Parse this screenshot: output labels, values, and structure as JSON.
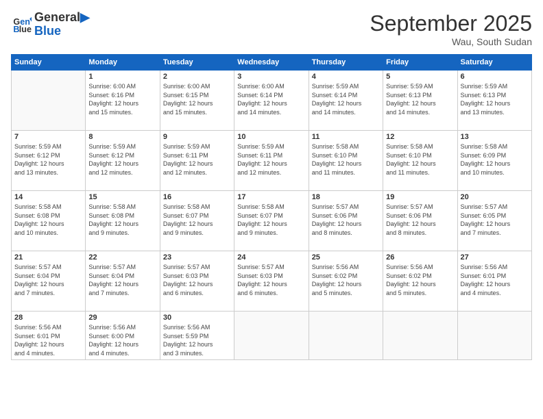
{
  "header": {
    "logo_line1": "General",
    "logo_line2": "Blue",
    "month": "September 2025",
    "location": "Wau, South Sudan"
  },
  "weekdays": [
    "Sunday",
    "Monday",
    "Tuesday",
    "Wednesday",
    "Thursday",
    "Friday",
    "Saturday"
  ],
  "weeks": [
    [
      {
        "day": "",
        "info": ""
      },
      {
        "day": "1",
        "info": "Sunrise: 6:00 AM\nSunset: 6:16 PM\nDaylight: 12 hours\nand 15 minutes."
      },
      {
        "day": "2",
        "info": "Sunrise: 6:00 AM\nSunset: 6:15 PM\nDaylight: 12 hours\nand 15 minutes."
      },
      {
        "day": "3",
        "info": "Sunrise: 6:00 AM\nSunset: 6:14 PM\nDaylight: 12 hours\nand 14 minutes."
      },
      {
        "day": "4",
        "info": "Sunrise: 5:59 AM\nSunset: 6:14 PM\nDaylight: 12 hours\nand 14 minutes."
      },
      {
        "day": "5",
        "info": "Sunrise: 5:59 AM\nSunset: 6:13 PM\nDaylight: 12 hours\nand 14 minutes."
      },
      {
        "day": "6",
        "info": "Sunrise: 5:59 AM\nSunset: 6:13 PM\nDaylight: 12 hours\nand 13 minutes."
      }
    ],
    [
      {
        "day": "7",
        "info": "Sunrise: 5:59 AM\nSunset: 6:12 PM\nDaylight: 12 hours\nand 13 minutes."
      },
      {
        "day": "8",
        "info": "Sunrise: 5:59 AM\nSunset: 6:12 PM\nDaylight: 12 hours\nand 12 minutes."
      },
      {
        "day": "9",
        "info": "Sunrise: 5:59 AM\nSunset: 6:11 PM\nDaylight: 12 hours\nand 12 minutes."
      },
      {
        "day": "10",
        "info": "Sunrise: 5:59 AM\nSunset: 6:11 PM\nDaylight: 12 hours\nand 12 minutes."
      },
      {
        "day": "11",
        "info": "Sunrise: 5:58 AM\nSunset: 6:10 PM\nDaylight: 12 hours\nand 11 minutes."
      },
      {
        "day": "12",
        "info": "Sunrise: 5:58 AM\nSunset: 6:10 PM\nDaylight: 12 hours\nand 11 minutes."
      },
      {
        "day": "13",
        "info": "Sunrise: 5:58 AM\nSunset: 6:09 PM\nDaylight: 12 hours\nand 10 minutes."
      }
    ],
    [
      {
        "day": "14",
        "info": "Sunrise: 5:58 AM\nSunset: 6:08 PM\nDaylight: 12 hours\nand 10 minutes."
      },
      {
        "day": "15",
        "info": "Sunrise: 5:58 AM\nSunset: 6:08 PM\nDaylight: 12 hours\nand 9 minutes."
      },
      {
        "day": "16",
        "info": "Sunrise: 5:58 AM\nSunset: 6:07 PM\nDaylight: 12 hours\nand 9 minutes."
      },
      {
        "day": "17",
        "info": "Sunrise: 5:58 AM\nSunset: 6:07 PM\nDaylight: 12 hours\nand 9 minutes."
      },
      {
        "day": "18",
        "info": "Sunrise: 5:57 AM\nSunset: 6:06 PM\nDaylight: 12 hours\nand 8 minutes."
      },
      {
        "day": "19",
        "info": "Sunrise: 5:57 AM\nSunset: 6:06 PM\nDaylight: 12 hours\nand 8 minutes."
      },
      {
        "day": "20",
        "info": "Sunrise: 5:57 AM\nSunset: 6:05 PM\nDaylight: 12 hours\nand 7 minutes."
      }
    ],
    [
      {
        "day": "21",
        "info": "Sunrise: 5:57 AM\nSunset: 6:04 PM\nDaylight: 12 hours\nand 7 minutes."
      },
      {
        "day": "22",
        "info": "Sunrise: 5:57 AM\nSunset: 6:04 PM\nDaylight: 12 hours\nand 7 minutes."
      },
      {
        "day": "23",
        "info": "Sunrise: 5:57 AM\nSunset: 6:03 PM\nDaylight: 12 hours\nand 6 minutes."
      },
      {
        "day": "24",
        "info": "Sunrise: 5:57 AM\nSunset: 6:03 PM\nDaylight: 12 hours\nand 6 minutes."
      },
      {
        "day": "25",
        "info": "Sunrise: 5:56 AM\nSunset: 6:02 PM\nDaylight: 12 hours\nand 5 minutes."
      },
      {
        "day": "26",
        "info": "Sunrise: 5:56 AM\nSunset: 6:02 PM\nDaylight: 12 hours\nand 5 minutes."
      },
      {
        "day": "27",
        "info": "Sunrise: 5:56 AM\nSunset: 6:01 PM\nDaylight: 12 hours\nand 4 minutes."
      }
    ],
    [
      {
        "day": "28",
        "info": "Sunrise: 5:56 AM\nSunset: 6:01 PM\nDaylight: 12 hours\nand 4 minutes."
      },
      {
        "day": "29",
        "info": "Sunrise: 5:56 AM\nSunset: 6:00 PM\nDaylight: 12 hours\nand 4 minutes."
      },
      {
        "day": "30",
        "info": "Sunrise: 5:56 AM\nSunset: 5:59 PM\nDaylight: 12 hours\nand 3 minutes."
      },
      {
        "day": "",
        "info": ""
      },
      {
        "day": "",
        "info": ""
      },
      {
        "day": "",
        "info": ""
      },
      {
        "day": "",
        "info": ""
      }
    ]
  ]
}
